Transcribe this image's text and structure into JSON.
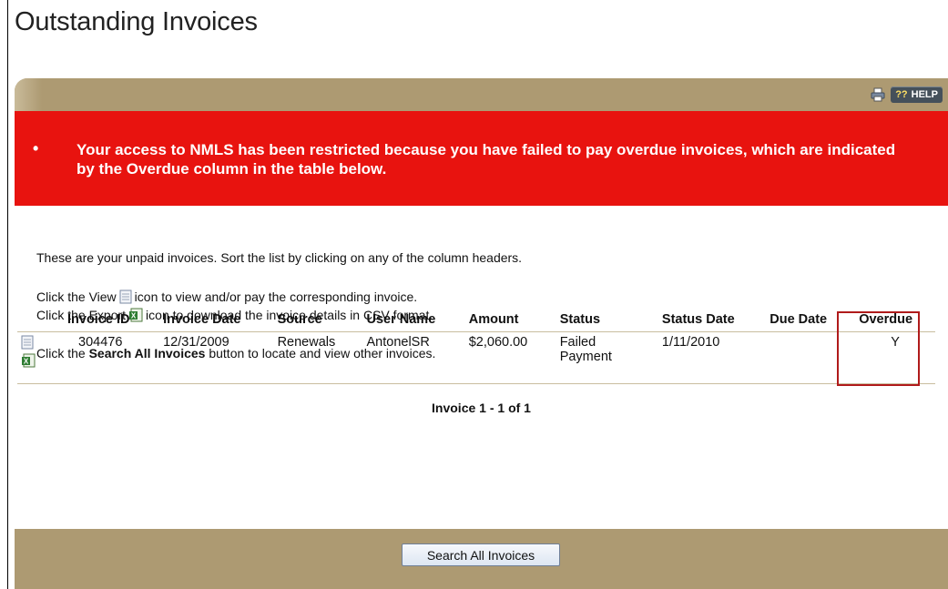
{
  "page": {
    "title": "Outstanding Invoices"
  },
  "toolbar": {
    "help_q": "??",
    "help_label": "HELP"
  },
  "alert": {
    "bullet": "•",
    "message": "Your access to NMLS has been restricted because you have failed to pay overdue invoices, which are indicated by the Overdue column in the table below."
  },
  "intro": {
    "line1": "These are your unpaid invoices. Sort the list by clicking on any of the column headers.",
    "view_prefix": "Click the View",
    "view_suffix": "icon to view and/or pay the corresponding invoice.",
    "export_prefix": "Click the Export",
    "export_suffix": "icon to download the invoice details in CSV format.",
    "search_prefix": "Click the",
    "search_bold": "Search All Invoices",
    "search_suffix": "button to locate and view other invoices."
  },
  "table": {
    "headers": [
      "Invoice ID",
      "Invoice Date",
      "Source",
      "User Name",
      "Amount",
      "Status",
      "Status Date",
      "Due Date",
      "Overdue"
    ],
    "rows": [
      {
        "invoice_id": "304476",
        "invoice_date": "12/31/2009",
        "source": "Renewals",
        "user_name": "AntonelSR",
        "amount": "$2,060.00",
        "status_line1": "Failed",
        "status_line2": "Payment",
        "status_date": "1/11/2010",
        "due_date": "",
        "overdue": "Y"
      }
    ]
  },
  "pager": {
    "text": "Invoice 1 - 1 of 1"
  },
  "footer": {
    "search_button": "Search All Invoices"
  },
  "colors": {
    "alert_bg": "#e8130f",
    "panel_tan": "#ad9a72",
    "overdue_outline": "#b01b1b"
  },
  "icons": [
    "print-icon",
    "help-icon",
    "view-invoice-icon",
    "export-csv-icon"
  ]
}
